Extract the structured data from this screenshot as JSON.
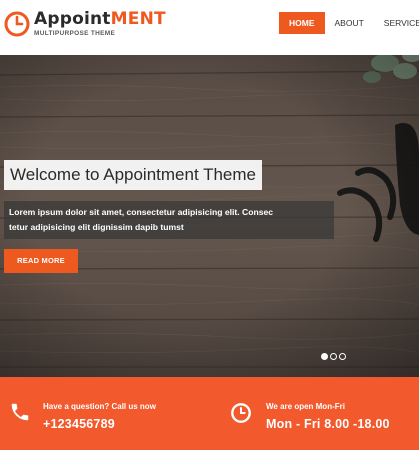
{
  "header": {
    "logo": {
      "name_dark": "Appoint",
      "name_accent": "MENT",
      "tagline": "MULTIPURPOSE THEME"
    },
    "nav": [
      {
        "label": "HOME",
        "active": true
      },
      {
        "label": "ABOUT",
        "active": false
      },
      {
        "label": "SERVICES",
        "active": false
      }
    ]
  },
  "hero": {
    "title": "Welcome to Appointment Theme",
    "description": "Lorem ipsum dolor sit amet, consectetur adipisicing elit. Consectetur adipisicing elit dignissim dapib tumst",
    "description_line1": "Lorem ipsum dolor sit amet, consectetur adipisicing elit. Consec",
    "description_line2": "tetur adipisicing elit dignissim dapib tumst",
    "button_label": "READ MORE",
    "slides": 3,
    "active_slide": 1
  },
  "info_bar": {
    "phone": {
      "icon": "phone-icon",
      "label": "Have a question? Call us now",
      "value": "+123456789"
    },
    "hours": {
      "icon": "clock-icon",
      "label": "We are open Mon-Fri",
      "value": "Mon - Fri 8.00 -18.00"
    }
  },
  "colors": {
    "accent": "#ee591f",
    "info_bar": "#f2592d",
    "wood": "#5b4f47"
  }
}
